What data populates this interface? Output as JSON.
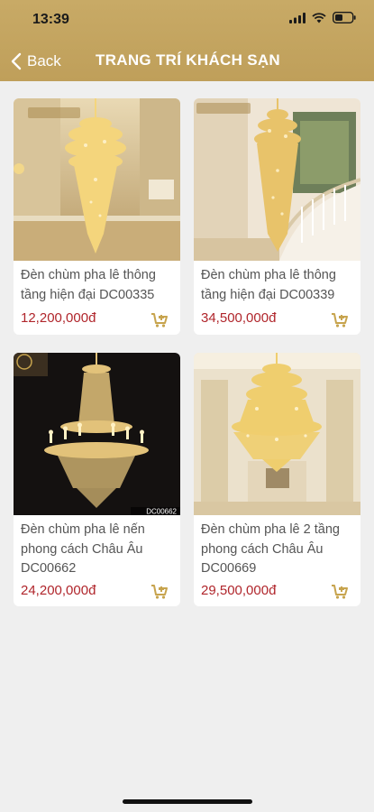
{
  "status_bar": {
    "time": "13:39"
  },
  "nav": {
    "back_label": "Back",
    "title": "TRANG TRÍ KHÁCH SẠN"
  },
  "products": [
    {
      "name": "Đèn chùm pha lê thông tầng hiện đại DC00335",
      "price": "12,200,000đ"
    },
    {
      "name": "Đèn chùm pha lê thông tầng hiện đại DC00339",
      "price": "34,500,000đ"
    },
    {
      "name": "Đèn chùm pha lê nến phong cách Châu Âu DC00662",
      "price": "24,200,000đ",
      "watermark": "DC00662"
    },
    {
      "name": "Đèn chùm pha lê 2 tầng phong cách Châu Âu DC00669",
      "price": "29,500,000đ"
    }
  ],
  "colors": {
    "header": "#c6a862",
    "price": "#b0252b",
    "cart_icon": "#c7a44e"
  },
  "icons": {
    "back": "chevron-left-icon",
    "cart": "add-to-cart-icon"
  }
}
